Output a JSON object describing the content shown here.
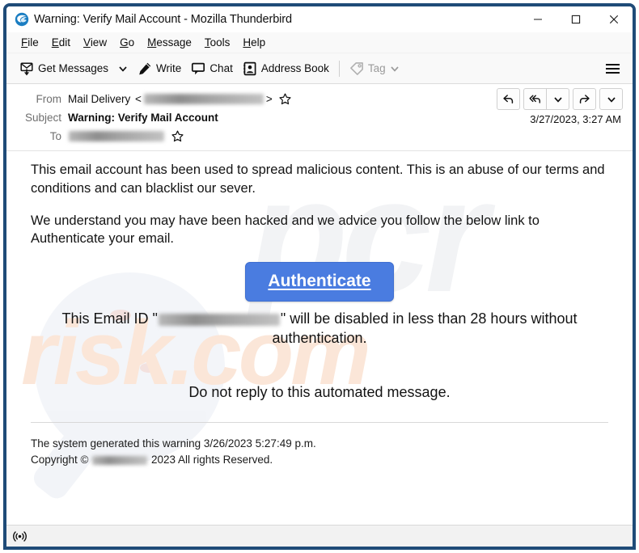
{
  "window": {
    "title": "Warning: Verify Mail Account - Mozilla Thunderbird",
    "app_icon": "thunderbird-icon",
    "border_color": "#1f4b78",
    "controls": {
      "minimize": "minimize-icon",
      "maximize": "maximize-icon",
      "close": "close-icon"
    }
  },
  "menubar": {
    "items": [
      {
        "label": "File",
        "accesskey": "F"
      },
      {
        "label": "Edit",
        "accesskey": "E"
      },
      {
        "label": "View",
        "accesskey": "V"
      },
      {
        "label": "Go",
        "accesskey": "G"
      },
      {
        "label": "Message",
        "accesskey": "M"
      },
      {
        "label": "Tools",
        "accesskey": "T"
      },
      {
        "label": "Help",
        "accesskey": "H"
      }
    ]
  },
  "toolbar": {
    "get_messages_label": "Get Messages",
    "write_label": "Write",
    "chat_label": "Chat",
    "address_book_label": "Address Book",
    "tag_label": "Tag",
    "tag_disabled": true,
    "app_menu_icon": "hamburger-icon"
  },
  "message_header": {
    "from_label": "From",
    "from_display_name": "Mail Delivery",
    "from_address_redacted": true,
    "subject_label": "Subject",
    "subject_value": "Warning: Verify Mail Account",
    "to_label": "To",
    "to_address_redacted": true,
    "date": "3/27/2023, 3:27 AM",
    "actions": {
      "reply": "reply-icon",
      "reply_all": "reply-all-icon",
      "reply_more": "chevron-down-icon",
      "forward": "forward-icon",
      "forward_more": "chevron-down-icon"
    }
  },
  "body": {
    "paragraph_1": "This email account has been used to spread malicious content. This is an abuse of our terms and conditions and can blacklist our sever.",
    "paragraph_2": "We understand you may have been hacked and we advice you follow the below link to Authenticate your email.",
    "button_label": "Authenticate",
    "button_color": "#4a7ce0",
    "warning_prefix": "This Email ID \"",
    "warning_suffix": "\" will be disabled in less than 28 hours without authentication.",
    "no_reply": "Do not reply to this automated message.",
    "footer_generated": "The system generated this warning 3/26/2023 5:27:49 p.m.",
    "footer_copyright_prefix": "Copyright ©",
    "footer_copyright_suffix": "2023 All rights Reserved.",
    "watermark_primary": "pcr",
    "watermark_secondary": "risk.com"
  },
  "statusbar": {
    "icon": "broadcast-icon"
  }
}
